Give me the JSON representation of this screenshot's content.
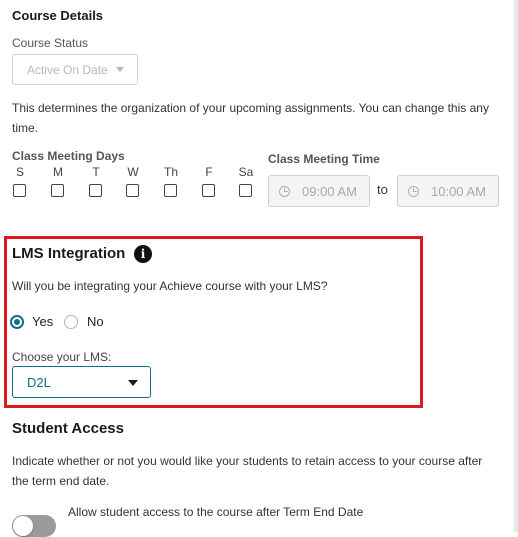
{
  "course_details": {
    "heading": "Course Details",
    "status_label": "Course Status",
    "status_value": "Active On Date",
    "description": "This determines the organization of your upcoming assignments. You can change this any time.",
    "meeting_days_label": "Class Meeting Days",
    "days": [
      "S",
      "M",
      "T",
      "W",
      "Th",
      "F",
      "Sa"
    ],
    "meeting_time_label": "Class Meeting Time",
    "start_time": "09:00 AM",
    "to_label": "to",
    "end_time": "10:00 AM"
  },
  "lms": {
    "heading": "LMS Integration",
    "info_glyph": "i",
    "question": "Will you be integrating your Achieve course with your LMS?",
    "yes_label": "Yes",
    "no_label": "No",
    "selected": "Yes",
    "choose_label": "Choose your LMS:",
    "selected_lms": "D2L",
    "highlight_color": "#e0191f",
    "accent_color": "#106f83"
  },
  "student_access": {
    "heading": "Student Access",
    "description": "Indicate whether or not you would like your students to retain access to your course after the term end date.",
    "toggle_label": "Allow student access to the course after Term End Date",
    "toggle_on": false
  }
}
